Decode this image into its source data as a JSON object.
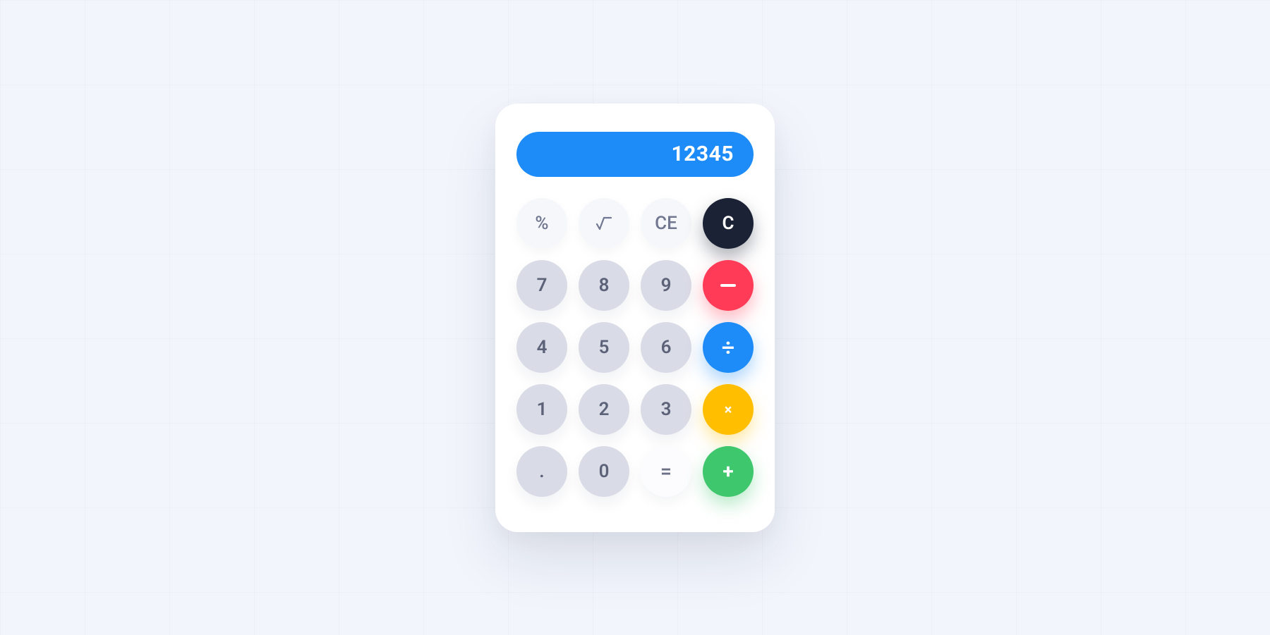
{
  "display": {
    "value": "12345"
  },
  "colors": {
    "display_bg": "#1d8cf8",
    "dark": "#1b2236",
    "red": "#ff3b57",
    "blue": "#1d8cf8",
    "yellow": "#ffbf00",
    "green": "#3ec76d",
    "num_bg": "#d9dbe6",
    "fn_bg": "#f5f7fb"
  },
  "keys": {
    "fn_percent": "%",
    "fn_sqrt": "√",
    "fn_clear_entry": "CE",
    "fn_clear": "C",
    "n7": "7",
    "n8": "8",
    "n9": "9",
    "op_minus": "−",
    "n4": "4",
    "n5": "5",
    "n6": "6",
    "op_divide": "÷",
    "n1": "1",
    "n2": "2",
    "n3": "3",
    "op_multiply": "×",
    "dot": ".",
    "n0": "0",
    "op_equal": "=",
    "op_plus": "+"
  }
}
